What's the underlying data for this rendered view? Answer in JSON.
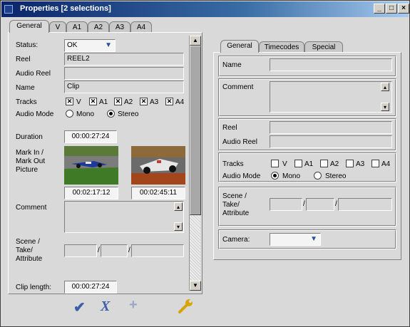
{
  "window": {
    "title": "Properties [2 selections]",
    "controls": {
      "minimize": "_",
      "maximize": "□",
      "close": "×"
    }
  },
  "left_tabs": [
    "General",
    "V",
    "A1",
    "A2",
    "A3",
    "A4"
  ],
  "left": {
    "status_label": "Status:",
    "status_value": "OK",
    "reel_label": "Reel",
    "reel_value": "REEL2",
    "audio_reel_label": "Audio Reel",
    "audio_reel_value": "",
    "name_label": "Name",
    "name_value": "Clip",
    "tracks_label": "Tracks",
    "tracks": [
      {
        "label": "V",
        "checked": true
      },
      {
        "label": "A1",
        "checked": true
      },
      {
        "label": "A2",
        "checked": true
      },
      {
        "label": "A3",
        "checked": true
      },
      {
        "label": "A4",
        "checked": true
      }
    ],
    "audio_mode_label": "Audio Mode",
    "audio_mode_options": [
      "Mono",
      "Stereo"
    ],
    "audio_mode_selected": "Stereo",
    "duration_label": "Duration",
    "duration_value": "00:00:27:24",
    "mark_label_1": "Mark In /",
    "mark_label_2": "Mark Out",
    "mark_label_3": "Picture",
    "mark_in_time": "00:02:17:12",
    "mark_out_time": "00:02:45:11",
    "comment_label": "Comment",
    "comment_value": "",
    "scene_label_1": "Scene /",
    "scene_label_2": "Take/",
    "scene_label_3": "Attribute",
    "scene_sep": "/",
    "clip_length_label": "Clip length:",
    "clip_length_value": "00:00:27:24"
  },
  "right_tabs": [
    "General",
    "Timecodes",
    "Special"
  ],
  "right": {
    "name_label": "Name",
    "comment_label": "Comment",
    "reel_label": "Reel",
    "audio_reel_label": "Audio Reel",
    "tracks_label": "Tracks",
    "tracks": [
      {
        "label": "V",
        "checked": false
      },
      {
        "label": "A1",
        "checked": false
      },
      {
        "label": "A2",
        "checked": false
      },
      {
        "label": "A3",
        "checked": false
      },
      {
        "label": "A4",
        "checked": false
      }
    ],
    "audio_mode_label": "Audio Mode",
    "audio_mode_options": [
      "Mono",
      "Stereo"
    ],
    "audio_mode_selected": "Mono",
    "scene_label_1": "Scene /",
    "scene_label_2": "Take/",
    "scene_label_3": "Attribute",
    "scene_sep": "/",
    "camera_label": "Camera:",
    "camera_value": ""
  },
  "bottom_buttons": [
    {
      "name": "ok-check-icon",
      "glyph": "✔",
      "color": "#3a5fa8"
    },
    {
      "name": "cancel-x-icon",
      "glyph": "X",
      "color": "#3a5fa8"
    },
    {
      "name": "add-plus-icon",
      "glyph": "+",
      "color": "#9aa6c6"
    },
    {
      "name": "wrench-icon",
      "glyph": "🔧",
      "color": "#d7a400"
    }
  ],
  "colors": {
    "title_start": "#0a246a",
    "title_end": "#a6caf0",
    "accent_blue": "#2a4da3",
    "wrench": "#d7a400"
  }
}
